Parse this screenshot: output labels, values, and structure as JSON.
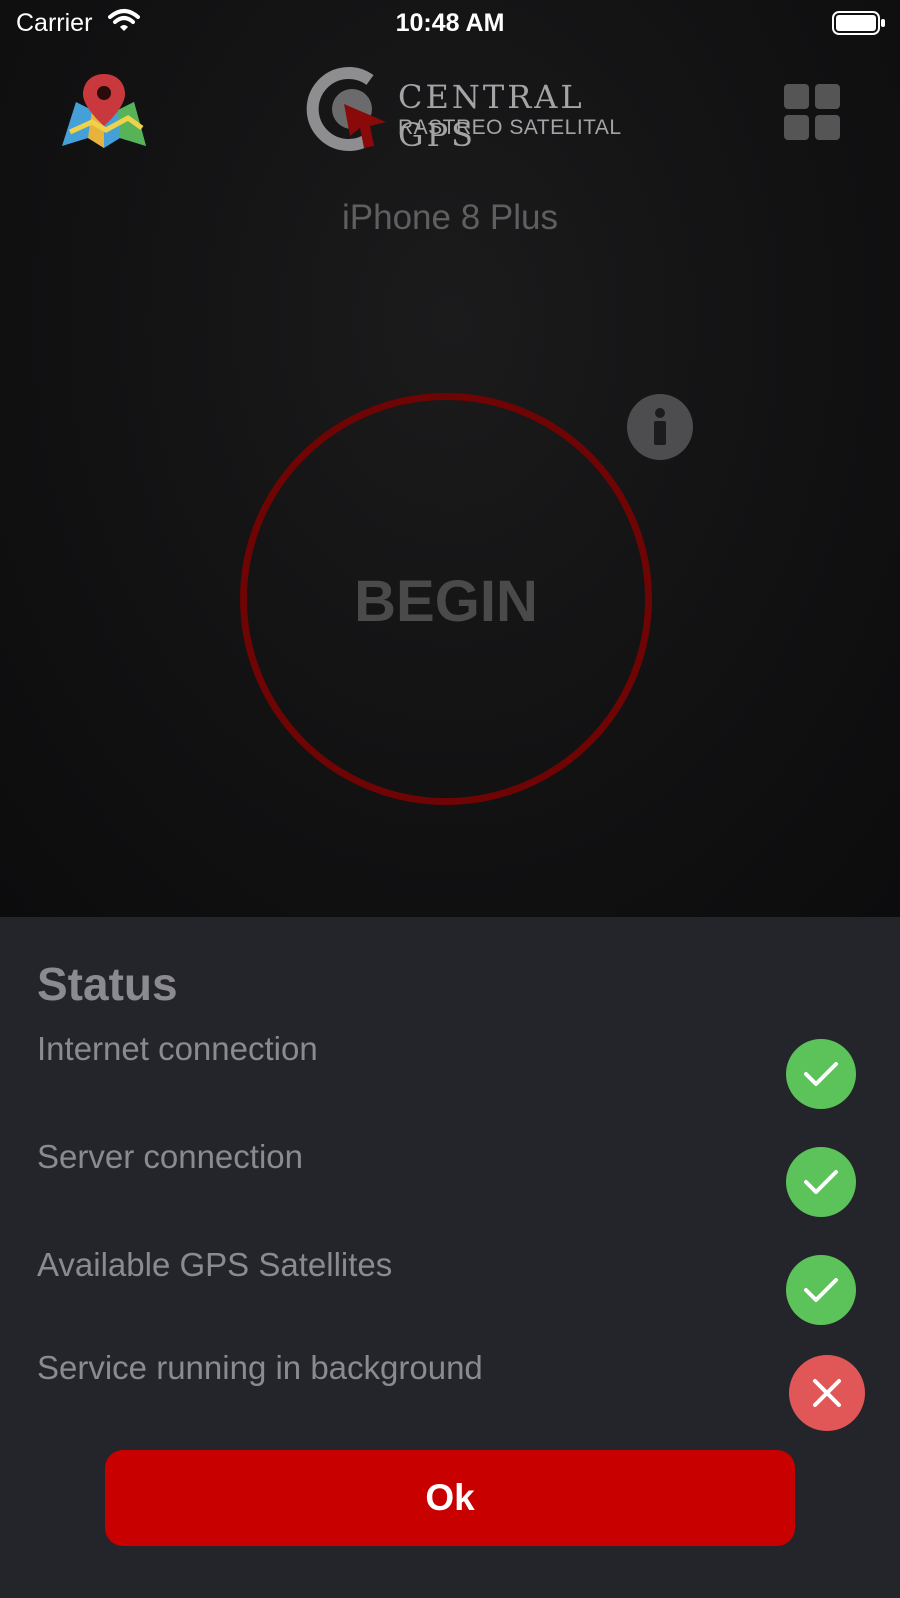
{
  "status_bar": {
    "carrier": "Carrier",
    "time": "10:48 AM"
  },
  "header": {
    "logo": {
      "line1": "CENTRAL GPS",
      "line2": "RASTREO SATELITAL"
    },
    "icons": {
      "left": "map-pin-icon",
      "right": "grid-menu-icon"
    }
  },
  "device": {
    "name": "iPhone 8 Plus"
  },
  "main": {
    "begin_label": "BEGIN",
    "info_icon": "info-icon",
    "ring_color": "#6e0404"
  },
  "status_sheet": {
    "title": "Status",
    "items": [
      {
        "label": "Internet connection",
        "state": "ok",
        "icon": "check-icon"
      },
      {
        "label": "Server connection",
        "state": "ok",
        "icon": "check-icon"
      },
      {
        "label": "Available GPS Satellites",
        "state": "ok",
        "icon": "check-icon"
      },
      {
        "label": "Service running in background",
        "state": "error",
        "icon": "close-icon"
      }
    ],
    "ok_label": "Ok"
  },
  "colors": {
    "ok": "#5cc25a",
    "error": "#e15757",
    "button": "#c80000",
    "sheet_bg": "#24252b"
  }
}
